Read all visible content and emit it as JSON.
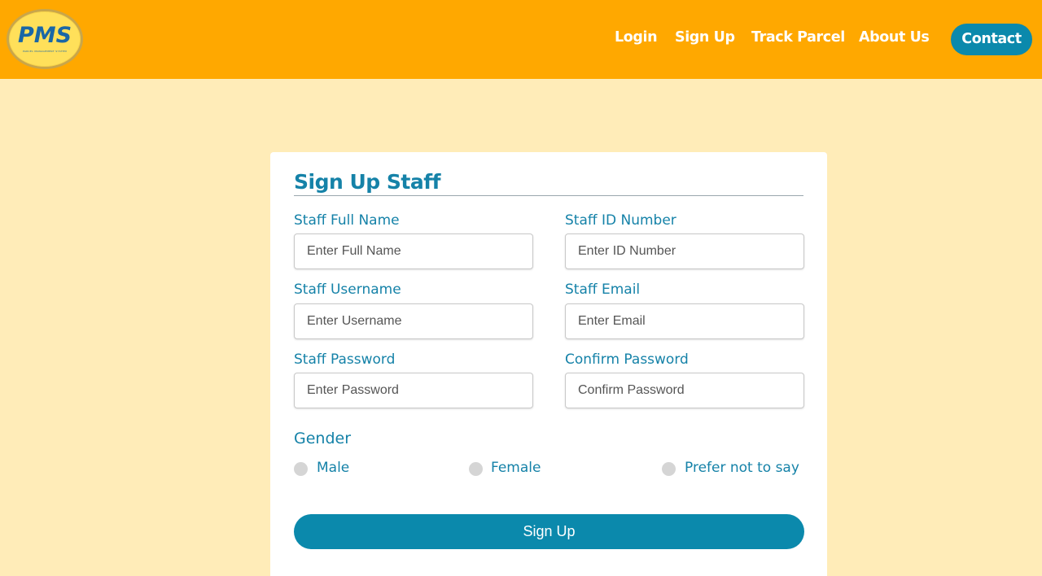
{
  "logo": {
    "text": "PMS",
    "subtext": "PARCEL MANAGEMENT SYSTEM"
  },
  "nav": {
    "login": "Login",
    "signup": "Sign Up",
    "track": "Track Parcel",
    "about": "About Us",
    "contact": "Contact"
  },
  "form": {
    "title": "Sign Up Staff",
    "fields": {
      "full_name": {
        "label": "Staff Full Name",
        "placeholder": "Enter Full Name",
        "value": ""
      },
      "id_number": {
        "label": "Staff ID Number",
        "placeholder": "Enter ID Number",
        "value": ""
      },
      "username": {
        "label": "Staff Username",
        "placeholder": "Enter Username",
        "value": ""
      },
      "email": {
        "label": "Staff Email",
        "placeholder": "Enter Email",
        "value": ""
      },
      "password": {
        "label": "Staff Password",
        "placeholder": "Enter Password",
        "value": ""
      },
      "confirm_password": {
        "label": "Confirm Password",
        "placeholder": "Confirm Password",
        "value": ""
      }
    },
    "gender": {
      "label": "Gender",
      "options": [
        "Male",
        "Female",
        "Prefer not to say"
      ]
    },
    "submit_label": "Sign Up"
  },
  "colors": {
    "header": "#ffa800",
    "page_background": "#ffecb8",
    "accent": "#0b89ac",
    "label_text": "#1582a8"
  }
}
